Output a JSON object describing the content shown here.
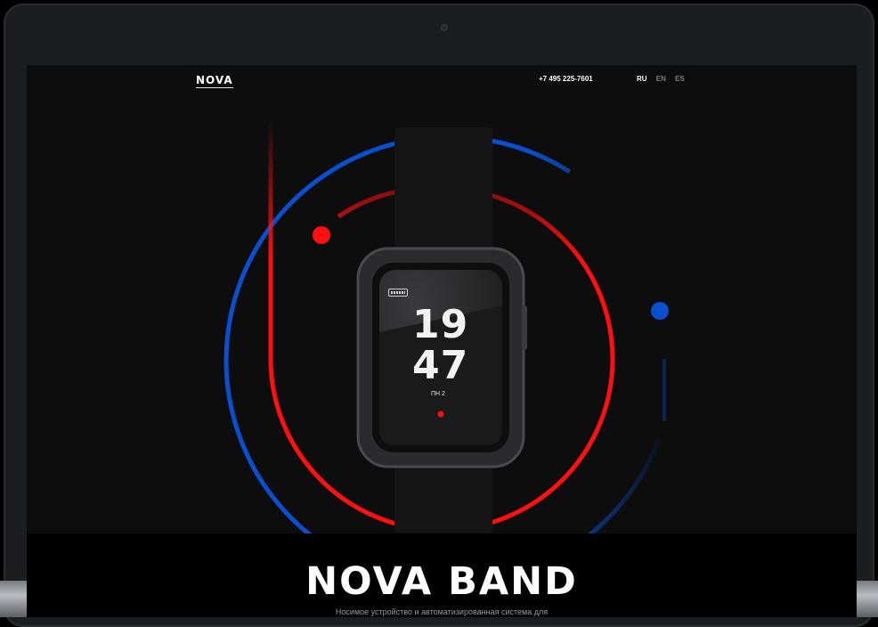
{
  "site": {
    "logo": "NOVA",
    "phone": "+7 495 225-7601",
    "languages": [
      {
        "code": "RU",
        "active": true
      },
      {
        "code": "EN",
        "active": false
      },
      {
        "code": "ES",
        "active": false
      }
    ]
  },
  "watch": {
    "hour": "19",
    "minute": "47",
    "day": "ПН 2"
  },
  "hero": {
    "title": "NOVA BAND",
    "subtitle": "Носимое устройство и автоматизированная система для"
  },
  "colors": {
    "accent_red": "#ff1010",
    "accent_blue": "#0a4fd0",
    "background": "#0d0d0e"
  }
}
